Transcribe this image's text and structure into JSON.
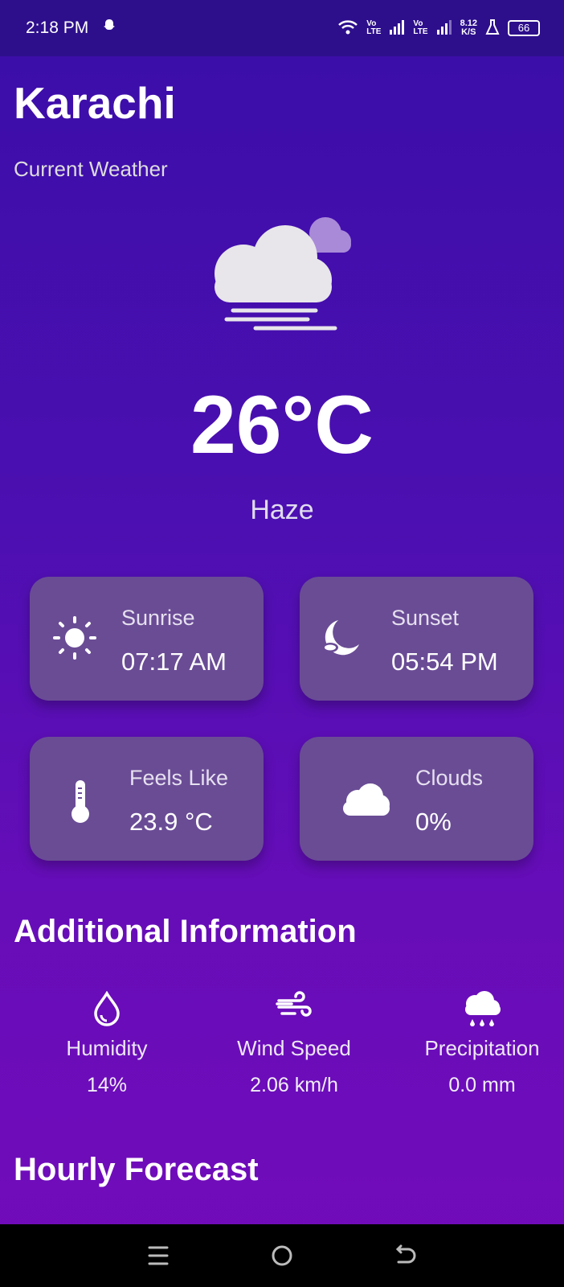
{
  "status": {
    "time": "2:18 PM",
    "lte1_top": "Vo",
    "lte1_bottom": "LTE",
    "lte2_top": "Vo",
    "lte2_bottom": "LTE",
    "net_speed_top": "8.12",
    "net_speed_bottom": "K/S",
    "battery": "66"
  },
  "header": {
    "city": "Karachi",
    "subtitle": "Current Weather"
  },
  "current": {
    "temp": "26°C",
    "condition": "Haze",
    "icon": "haze-cloud-icon"
  },
  "cards": [
    {
      "label": "Sunrise",
      "value": "07:17 AM",
      "icon": "sun-icon"
    },
    {
      "label": "Sunset",
      "value": "05:54 PM",
      "icon": "moon-icon"
    },
    {
      "label": "Feels Like",
      "value": "23.9 °C",
      "icon": "thermometer-icon"
    },
    {
      "label": "Clouds",
      "value": "0%",
      "icon": "cloud-icon"
    }
  ],
  "additional": {
    "title": "Additional Information",
    "items": [
      {
        "label": "Humidity",
        "value": "14%",
        "icon": "water-drop-icon"
      },
      {
        "label": "Wind Speed",
        "value": "2.06 km/h",
        "icon": "wind-icon"
      },
      {
        "label": "Precipitation",
        "value": "0.0 mm",
        "icon": "rain-cloud-icon"
      }
    ]
  },
  "hourly": {
    "title": "Hourly Forecast"
  },
  "colors": {
    "background_top": "#3a0ea8",
    "background_bottom": "#730bbb",
    "card": "#6a4c95",
    "status_bar": "#2d0f8c"
  }
}
